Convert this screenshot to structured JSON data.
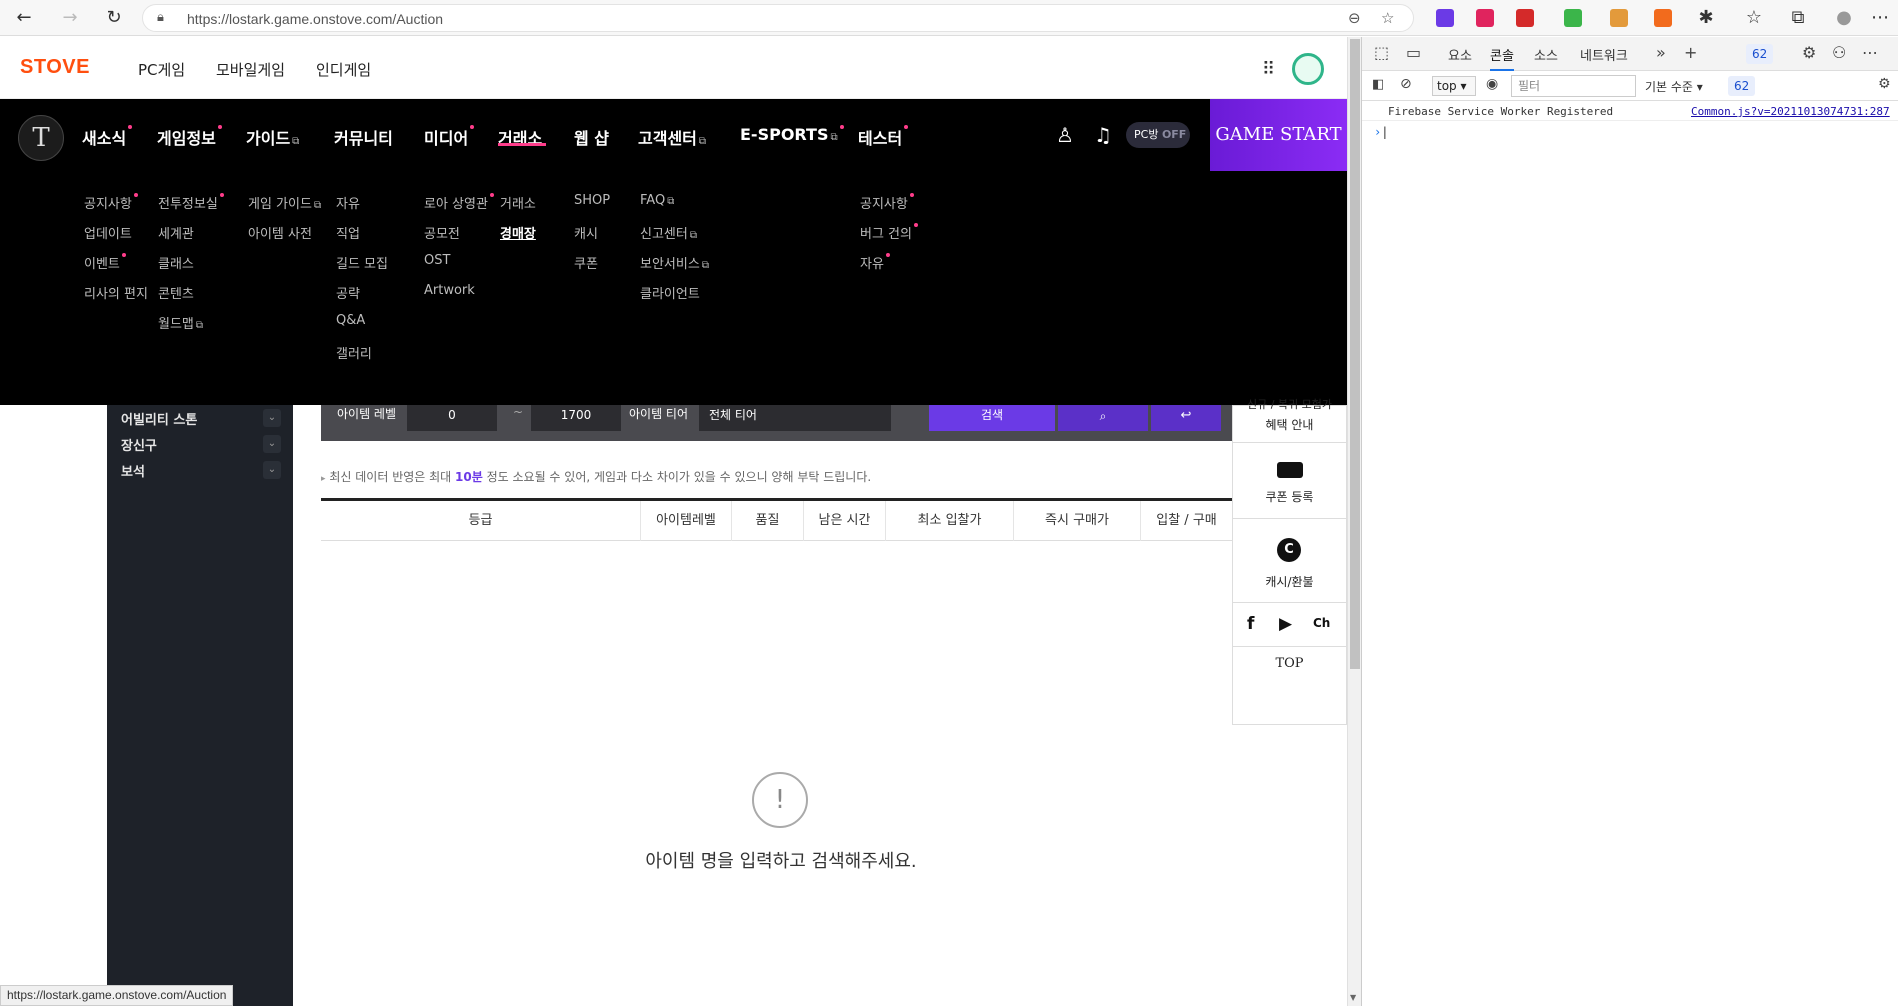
{
  "browser": {
    "url": "https://lostark.game.onstove.com/Auction",
    "status_url": "https://lostark.game.onstove.com/Auction"
  },
  "stove": {
    "logo": "STOVE",
    "links": [
      "PC게임",
      "모바일게임",
      "인디게임"
    ]
  },
  "game_nav": {
    "items": [
      {
        "label": "새소식",
        "dot": true
      },
      {
        "label": "게임정보",
        "dot": true
      },
      {
        "label": "가이드",
        "ext": true
      },
      {
        "label": "커뮤니티"
      },
      {
        "label": "미디어",
        "dot": true
      },
      {
        "label": "거래소"
      },
      {
        "label": "웹 샵"
      },
      {
        "label": "고객센터",
        "ext": true
      },
      {
        "label": "E-SPORTS",
        "ext": true,
        "dot": true
      },
      {
        "label": "테스터",
        "dot": true
      }
    ],
    "pcbang": "PC방",
    "pcbang_state": "OFF",
    "game_start": "GAME START"
  },
  "mega_menu": {
    "col1": [
      "공지사항",
      "업데이트",
      "이벤트",
      "리사의 편지"
    ],
    "col2": [
      "전투정보실",
      "세계관",
      "클래스",
      "콘텐츠",
      "월드맵"
    ],
    "col3": [
      "게임 가이드",
      "아이템 사전"
    ],
    "col4": [
      "자유",
      "직업",
      "길드 모집",
      "공략",
      "Q&A",
      "갤러리"
    ],
    "col5": [
      "로아 상영관",
      "공모전",
      "OST",
      "Artwork"
    ],
    "col6": [
      "거래소",
      "경매장"
    ],
    "col7": [
      "SHOP",
      "캐시",
      "쿠폰"
    ],
    "col8": [
      "FAQ",
      "신고센터",
      "보안서비스",
      "클라이언트"
    ],
    "col9": [
      "공지사항",
      "버그 건의",
      "자유"
    ]
  },
  "left_panel": [
    "어빌리티 스톤",
    "장신구",
    "보석"
  ],
  "search_strip": {
    "item_level_label": "아이템 레벨",
    "level_min": "0",
    "level_sep": "~",
    "level_max": "1700",
    "item_tier_label": "아이템 티어",
    "tier_value": "전체 티어",
    "search_btn": "검색"
  },
  "notice": {
    "before": "최신 데이터 반영은 최대 ",
    "highlight": "10분",
    "after": " 정도 소요될 수 있어, 게임과 다소 차이가 있을 수 있으니 양해 부탁 드립니다."
  },
  "table_headers": [
    "등급",
    "아이템레벨",
    "품질",
    "남은 시간",
    "최소 입찰가",
    "즉시 구매가",
    "입찰 / 구매"
  ],
  "empty": {
    "icon": "!",
    "message": "아이템 명을 입력하고 검색해주세요."
  },
  "right_widget": {
    "top_text_1": "신규 / 복귀 모험가",
    "top_text_2": "혜택 안내",
    "coupon": "쿠폰 등록",
    "cash": "캐시/환불",
    "cash_icon": "C",
    "sns": [
      "f",
      "▶",
      "Ch"
    ],
    "top": "TOP"
  },
  "devtools": {
    "tabs": [
      "요소",
      "콘솔",
      "소스",
      "네트워크"
    ],
    "active_tab": "콘솔",
    "badge_count": "62",
    "context": "top",
    "filter_placeholder": "필터",
    "levels": "기본 수준",
    "log_message": "Firebase Service Worker Registered",
    "log_source": "Common.js?v=20211013074731:287",
    "prompt": "›"
  },
  "colors": {
    "stove_orange": "#ff4f0f",
    "accent_pink": "#ff3d8b",
    "purple": "#6b3ae6"
  }
}
